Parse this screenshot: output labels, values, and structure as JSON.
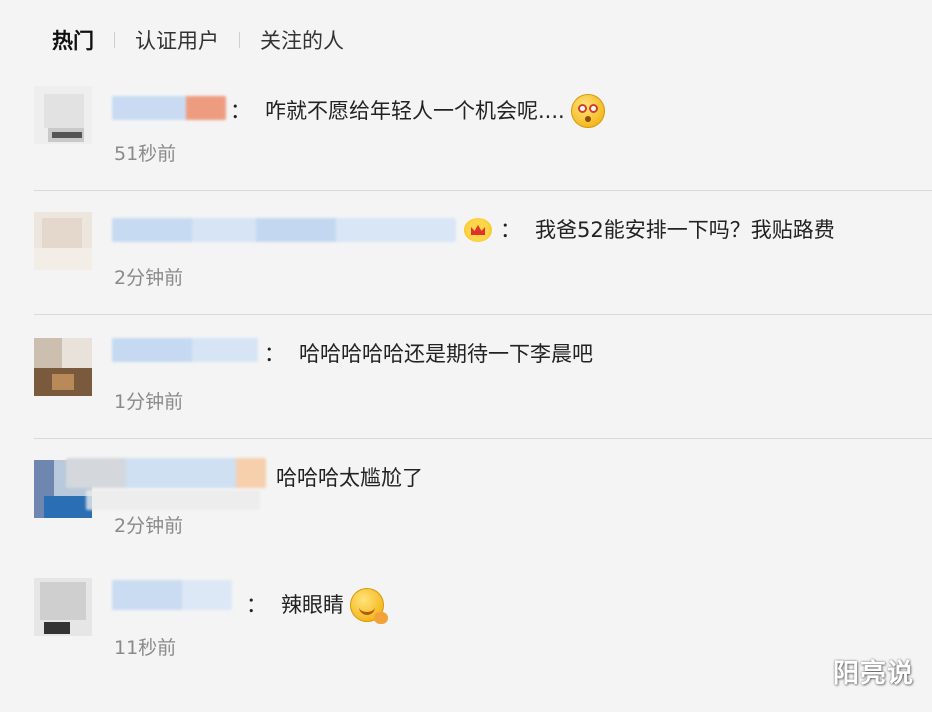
{
  "tabs": [
    {
      "label": "热门",
      "active": true
    },
    {
      "label": "认证用户",
      "active": false
    },
    {
      "label": "关注的人",
      "active": false
    }
  ],
  "comments": [
    {
      "text": "咋就不愿给年轻人一个机会呢....",
      "time": "51秒前",
      "emoji": "amazed-face-emoji"
    },
    {
      "text": "我爸52能安排一下吗？我贴路费",
      "time": "2分钟前",
      "badge": "crown-icon"
    },
    {
      "text": "哈哈哈哈哈还是期待一下李晨吧",
      "time": "1分钟前"
    },
    {
      "text": "哈哈哈太尴尬了",
      "time": "2分钟前"
    },
    {
      "text": "辣眼睛",
      "time": "11秒前",
      "emoji": "tongue-face-emoji"
    }
  ],
  "colon": "：",
  "watermark": "阳亮说",
  "colors": {
    "background": "#f4f4f4",
    "divider": "#dadada",
    "time_text": "#8a8a8a",
    "name_blur_blue": "#c9dcf3"
  }
}
